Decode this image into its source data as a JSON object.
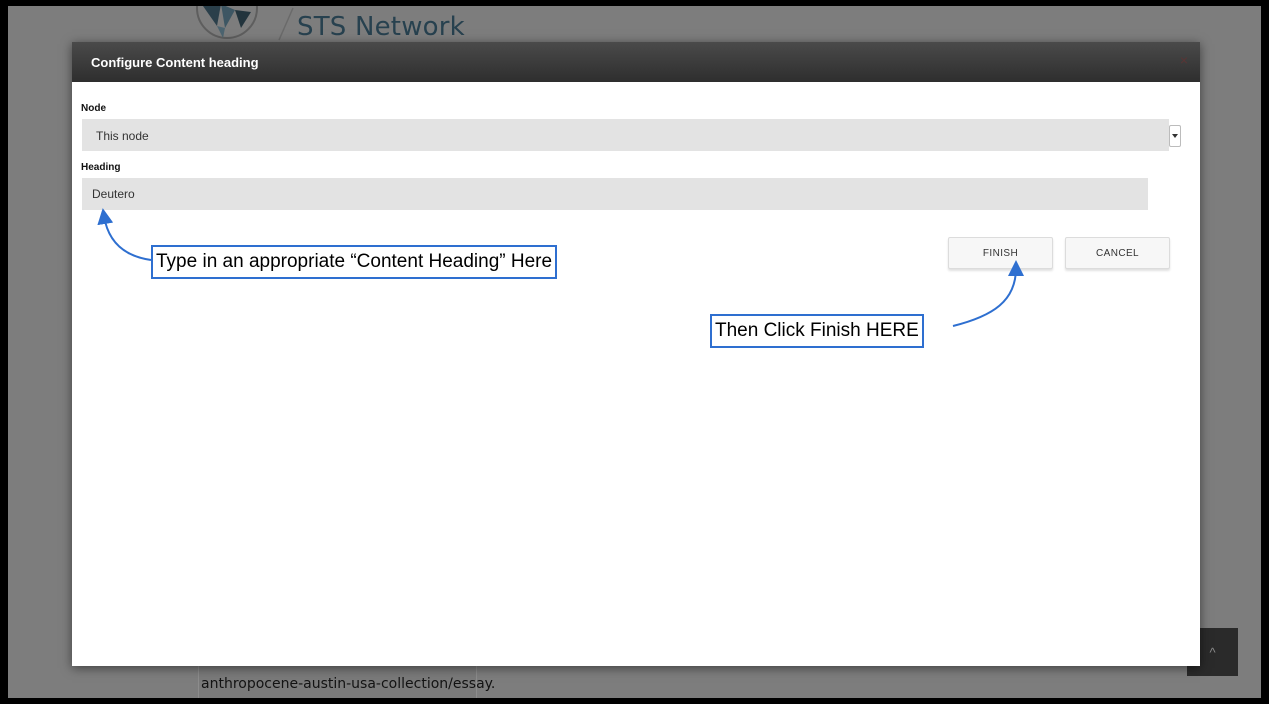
{
  "background": {
    "site_title": "STS Network",
    "link_text": "anthropocene-austin-usa-collection/essay.",
    "scroll_top_glyph": "^"
  },
  "modal": {
    "title": "Configure Content heading",
    "close_glyph": "×",
    "fields": {
      "node": {
        "label": "Node",
        "selected_value": "This node"
      },
      "heading": {
        "label": "Heading",
        "value": "Deutero"
      }
    },
    "buttons": {
      "finish": "FINISH",
      "cancel": "CANCEL"
    }
  },
  "annotations": {
    "heading_hint": "Type in an appropriate “Content Heading” Here",
    "finish_hint": "Then Click Finish HERE"
  },
  "colors": {
    "annotation_border": "#2e6fd0",
    "modal_header": "#3a3a3a",
    "overlay": "#7d7d7d",
    "field_bg": "#e3e3e3"
  },
  "icons": {
    "select_arrow": "caret-down-icon",
    "close": "close-icon",
    "logo": "network-logo-icon"
  }
}
